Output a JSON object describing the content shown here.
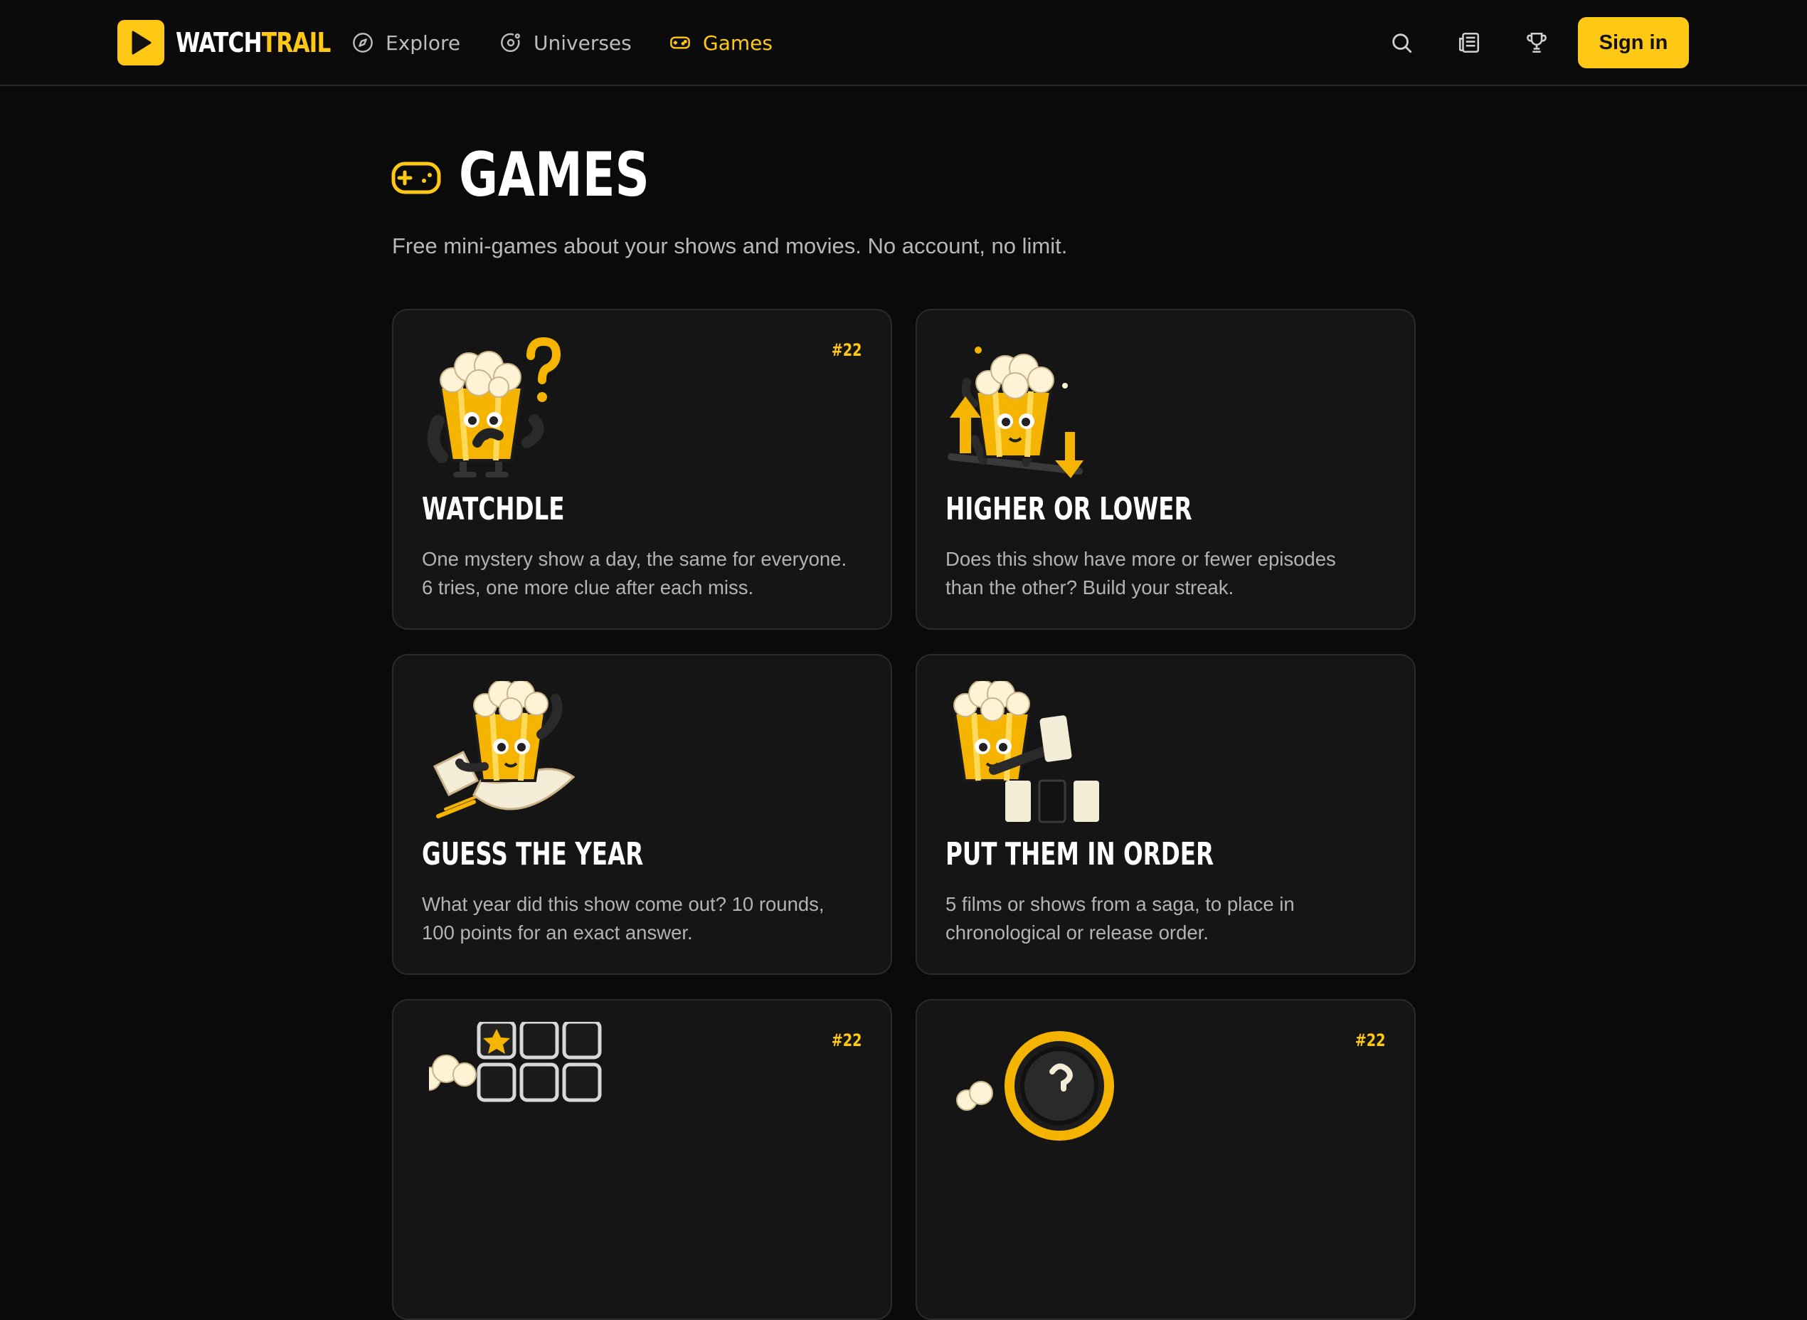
{
  "brand": {
    "part1": "WATCH",
    "part2": "TRAIL",
    "accent": "#ffc814"
  },
  "nav": [
    {
      "label": "Explore",
      "icon": "compass-icon"
    },
    {
      "label": "Universes",
      "icon": "orbit-icon"
    },
    {
      "label": "Games",
      "icon": "gamepad-icon",
      "active": true
    }
  ],
  "header_icons": [
    "search-icon",
    "newspaper-icon",
    "trophy-icon"
  ],
  "signin_label": "Sign in",
  "page": {
    "title": "GAMES",
    "subtitle": "Free mini-games about your shows and movies. No account, no limit."
  },
  "cards": [
    {
      "title": "WATCHDLE",
      "badge": "#22",
      "desc_line1": "One mystery show a day, the same for everyone.",
      "desc_line2": "6 tries, one more clue after each miss."
    },
    {
      "title": "HIGHER OR LOWER",
      "badge": "",
      "desc_line1": "Does this show have more or fewer episodes",
      "desc_line2": "than the other? Build your streak."
    },
    {
      "title": "GUESS THE YEAR",
      "badge": "",
      "desc_line1": "What year did this show come out? 10 rounds,",
      "desc_line2": "100 points for an exact answer."
    },
    {
      "title": "PUT THEM IN ORDER",
      "badge": "",
      "desc_line1": "5 films or shows from a saga, to place in",
      "desc_line2": "chronological or release order."
    },
    {
      "title": "",
      "badge": "#22",
      "desc_line1": "",
      "desc_line2": ""
    },
    {
      "title": "",
      "badge": "#22",
      "desc_line1": "",
      "desc_line2": ""
    }
  ]
}
